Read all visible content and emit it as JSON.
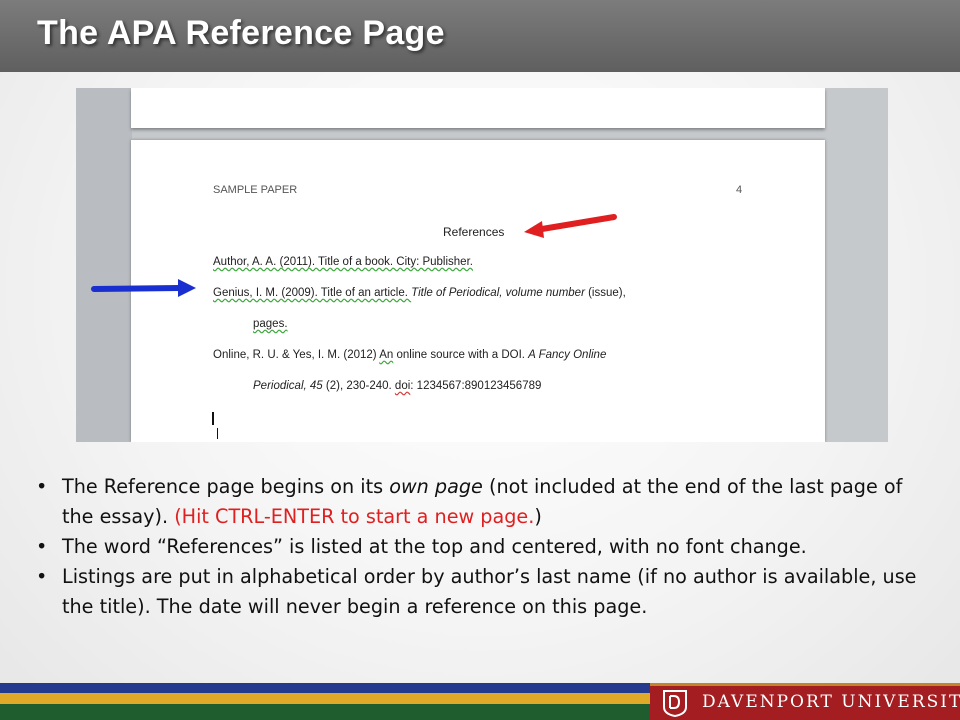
{
  "slide": {
    "title": "The APA Reference Page"
  },
  "document": {
    "header_left": "SAMPLE PAPER",
    "header_page": "4",
    "heading": "References",
    "ref1": "Author, A. A. (2011). Title of a book. City: Publisher.",
    "ref2_plain": "Genius, I. M. (2009). Title of an article. ",
    "ref2_italic": "Title of Periodical, volume number",
    "ref2_tail": " (issue),",
    "ref2_cont": "pages.",
    "ref3_line1_a": "Online, R. U. & Yes, I. M. (2012) ",
    "ref3_line1_b": "An",
    "ref3_line1_c": " online source with a DOI. ",
    "ref3_line1_italic": "A Fancy Online",
    "ref3_line2_italic": "Periodical, 45",
    "ref3_line2_a": " (2), 230-240. ",
    "ref3_line2_doi": "doi",
    "ref3_line2_b": ": 1234567:890123456789"
  },
  "bullets": [
    {
      "p1": "The Reference page begins on its ",
      "italic": "own page",
      "p2": " (not included at the end of the last page of the essay).  ",
      "highlight": "(Hit CTRL-ENTER to start a new page.",
      "p3": ")"
    },
    {
      "text": "The word “References” is listed at the top and centered, with no font change."
    },
    {
      "text": "Listings are put in alphabetical order by author’s last name (if no author is available, use the title).  The date will never begin a reference on this page."
    }
  ],
  "bullet_symbol": "•",
  "footer": {
    "logo_text": "DAVENPORT UNIVERSITY",
    "logo_icon": "du-shield-icon"
  },
  "colors": {
    "title_bar": "#6b6b6b",
    "highlight_red": "#e02020",
    "arrow_red": "#e02020",
    "arrow_blue": "#1a2fd0",
    "stripe_navy": "#243a8c",
    "stripe_gold": "#e0a928",
    "stripe_green": "#1f5d2f",
    "logo_red": "#a31d21"
  }
}
